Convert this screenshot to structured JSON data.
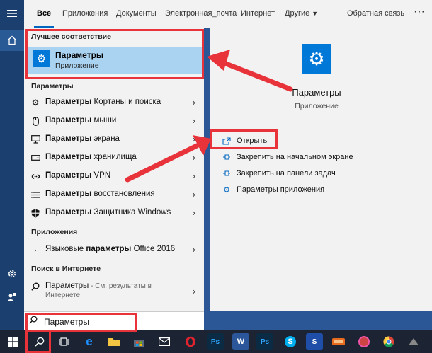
{
  "tabs": [
    "Все",
    "Приложения",
    "Документы",
    "Электронная_почта",
    "Интернет",
    "Другие",
    "Обратная связь"
  ],
  "tabs_more": "···",
  "best_match": {
    "header": "Лучшее соответствие",
    "title": "Параметры",
    "subtitle": "Приложение"
  },
  "settings_section": {
    "header": "Параметры",
    "items": [
      {
        "icon": "gear-icon",
        "bold": "Параметры",
        "rest": " Кортаны и поиска"
      },
      {
        "icon": "mouse-icon",
        "bold": "Параметры",
        "rest": " мыши"
      },
      {
        "icon": "monitor-icon",
        "bold": "Параметры",
        "rest": " экрана"
      },
      {
        "icon": "storage-icon",
        "bold": "Параметры",
        "rest": " хранилища"
      },
      {
        "icon": "vpn-icon",
        "bold": "Параметры",
        "rest": " VPN"
      },
      {
        "icon": "recovery-icon",
        "bold": "Параметры",
        "rest": " восстановления"
      },
      {
        "icon": "shield-icon",
        "bold": "Параметры",
        "rest": " Защитника Windows"
      }
    ]
  },
  "apps_section": {
    "header": "Приложения",
    "items": [
      {
        "icon": "language-icon",
        "pre": "Языковые ",
        "bold": "параметры",
        "rest": " Office 2016"
      }
    ]
  },
  "web_section": {
    "header": "Поиск в Интернете",
    "item": {
      "bold": "Параметры",
      "rest": " - См. результаты в",
      "line2": "Интернете"
    }
  },
  "right_pane": {
    "app_name": "Параметры",
    "app_kind": "Приложение",
    "actions": [
      {
        "icon": "open-icon",
        "label": "Открыть"
      },
      {
        "icon": "pin-icon",
        "label": "Закрепить на начальном экране"
      },
      {
        "icon": "pin-icon",
        "label": "Закрепить на панели задач"
      },
      {
        "icon": "gear-icon",
        "label": "Параметры приложения"
      }
    ]
  },
  "search": {
    "value": "Параметры"
  },
  "colors": {
    "accent": "#0078d7",
    "highlight": "#e8333a",
    "selection": "#a9d3f1"
  }
}
